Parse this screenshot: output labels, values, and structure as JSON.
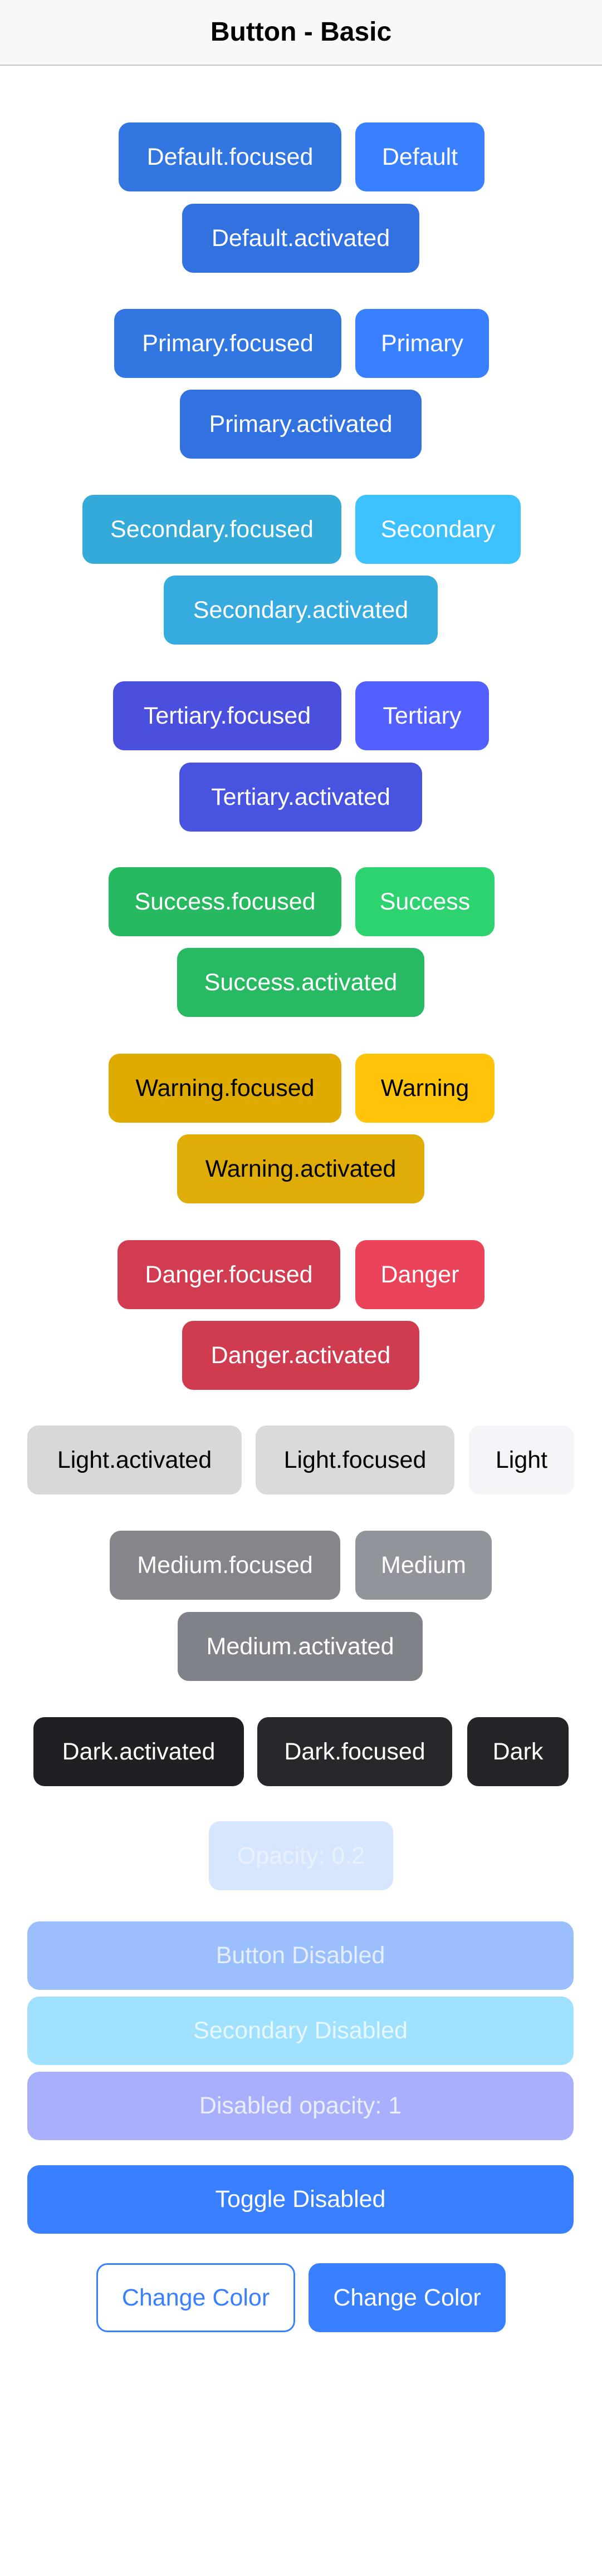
{
  "header": {
    "title": "Button - Basic"
  },
  "buttons": {
    "default_focused": "Default.focused",
    "default": "Default",
    "default_activated": "Default.activated",
    "primary_focused": "Primary.focused",
    "primary": "Primary",
    "primary_activated": "Primary.activated",
    "secondary_focused": "Secondary.focused",
    "secondary": "Secondary",
    "secondary_activated": "Secondary.activated",
    "tertiary_focused": "Tertiary.focused",
    "tertiary": "Tertiary",
    "tertiary_activated": "Tertiary.activated",
    "success_focused": "Success.focused",
    "success": "Success",
    "success_activated": "Success.activated",
    "warning_focused": "Warning.focused",
    "warning": "Warning",
    "warning_activated": "Warning.activated",
    "danger_focused": "Danger.focused",
    "danger": "Danger",
    "danger_activated": "Danger.activated",
    "light_activated": "Light.activated",
    "light_focused": "Light.focused",
    "light": "Light",
    "medium_focused": "Medium.focused",
    "medium": "Medium",
    "medium_activated": "Medium.activated",
    "dark_activated": "Dark.activated",
    "dark_focused": "Dark.focused",
    "dark": "Dark",
    "opacity": "Opacity: 0.2",
    "button_disabled": "Button Disabled",
    "secondary_disabled": "Secondary Disabled",
    "disabled_opacity": "Disabled opacity: 1",
    "toggle_disabled": "Toggle Disabled",
    "change_color_outline": "Change Color",
    "change_color_solid": "Change Color"
  },
  "colors": {
    "primary": "#3880ff",
    "secondary": "#3dc2ff",
    "tertiary": "#5260ff",
    "success": "#2dd36f",
    "warning": "#ffc409",
    "danger": "#eb445a",
    "light": "#f4f5f8",
    "medium": "#92949c",
    "dark": "#222428"
  }
}
